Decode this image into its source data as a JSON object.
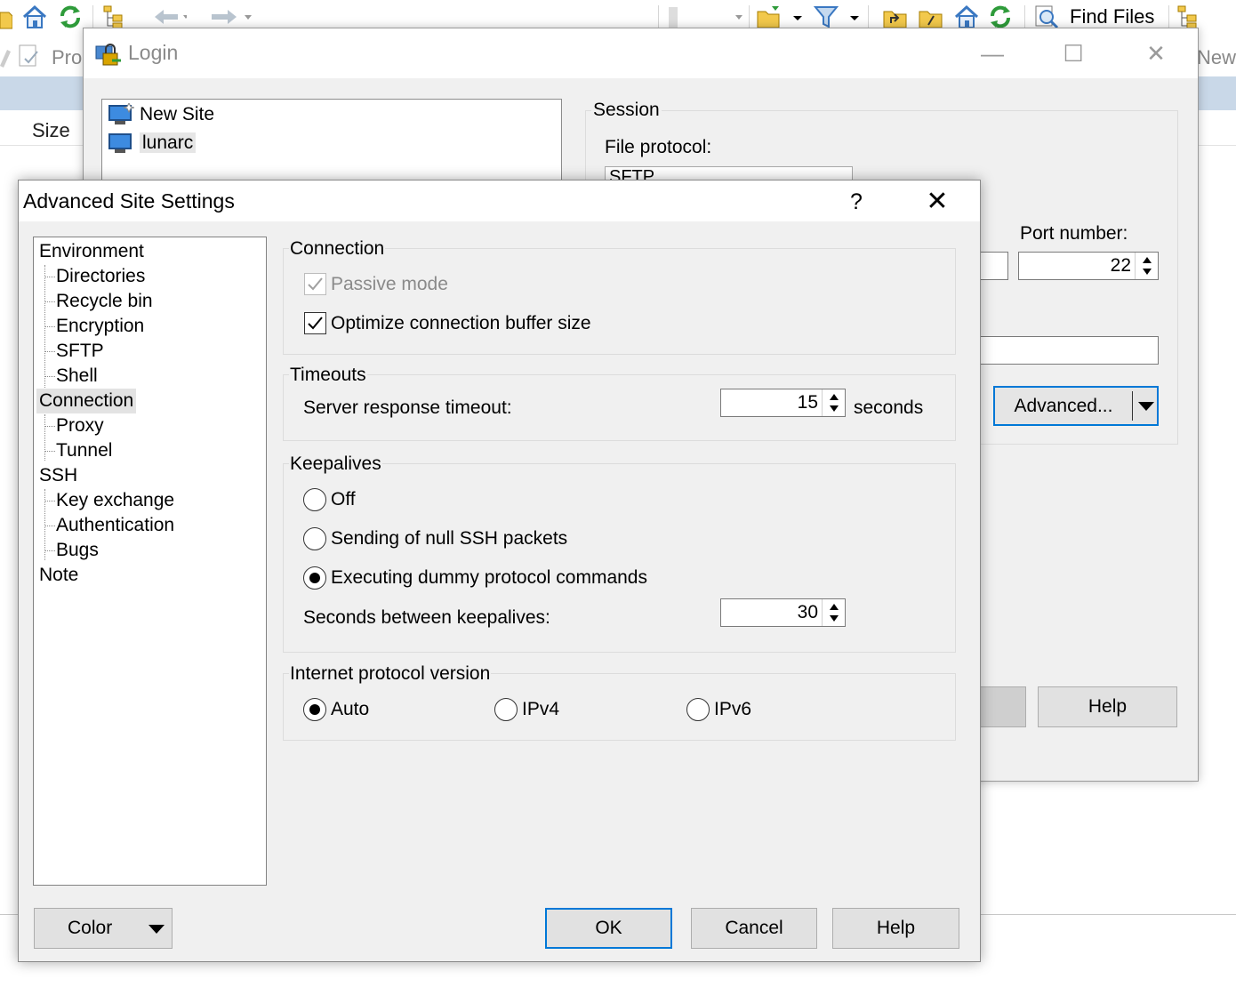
{
  "app": {
    "find_files_label": "Find Files",
    "size_header": "Size",
    "pro_label": "Pro",
    "new_label": "New"
  },
  "login": {
    "title": "Login",
    "sites": [
      {
        "label": "New Site",
        "icon": "new-site-monitor-icon"
      },
      {
        "label": "lunarc",
        "icon": "site-monitor-icon",
        "selected": true
      }
    ],
    "session_label": "Session",
    "file_protocol_label": "File protocol:",
    "file_protocol_value": "SFTP",
    "port_label": "Port number:",
    "port_value": "22",
    "advanced_label": "Advanced...",
    "help_label": "Help"
  },
  "dialog": {
    "title": "Advanced Site Settings",
    "help_glyph": "?",
    "close_glyph": "✕",
    "tree": [
      {
        "label": "Environment",
        "level": 0
      },
      {
        "label": "Directories",
        "level": 1
      },
      {
        "label": "Recycle bin",
        "level": 1
      },
      {
        "label": "Encryption",
        "level": 1
      },
      {
        "label": "SFTP",
        "level": 1
      },
      {
        "label": "Shell",
        "level": 1
      },
      {
        "label": "Connection",
        "level": 0,
        "selected": true
      },
      {
        "label": "Proxy",
        "level": 1
      },
      {
        "label": "Tunnel",
        "level": 1
      },
      {
        "label": "SSH",
        "level": 0
      },
      {
        "label": "Key exchange",
        "level": 1
      },
      {
        "label": "Authentication",
        "level": 1
      },
      {
        "label": "Bugs",
        "level": 1
      },
      {
        "label": "Note",
        "level": 0
      }
    ],
    "connection": {
      "label": "Connection",
      "passive_mode": {
        "label": "Passive mode",
        "checked": true,
        "disabled": true
      },
      "optimize_buffer": {
        "label": "Optimize connection buffer size",
        "checked": true
      }
    },
    "timeouts": {
      "label": "Timeouts",
      "server_response_label": "Server response timeout:",
      "server_response_value": "15",
      "unit": "seconds"
    },
    "keepalives": {
      "label": "Keepalives",
      "options": [
        {
          "label": "Off",
          "selected": false
        },
        {
          "label": "Sending of null SSH packets",
          "selected": false
        },
        {
          "label": "Executing dummy protocol commands",
          "selected": true
        }
      ],
      "interval_label": "Seconds between keepalives:",
      "interval_value": "30"
    },
    "ip_version": {
      "label": "Internet protocol version",
      "options": [
        {
          "label": "Auto",
          "selected": true
        },
        {
          "label": "IPv4",
          "selected": false
        },
        {
          "label": "IPv6",
          "selected": false
        }
      ]
    },
    "buttons": {
      "color": "Color",
      "ok": "OK",
      "cancel": "Cancel",
      "help": "Help"
    },
    "accent_color": "#0078d7"
  }
}
